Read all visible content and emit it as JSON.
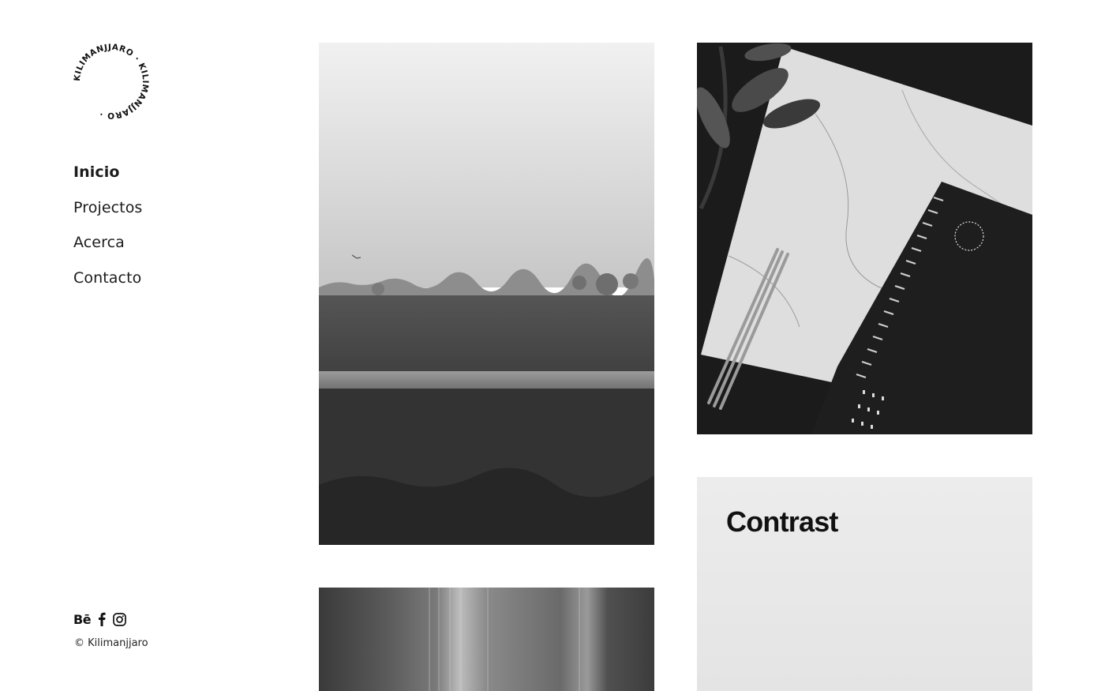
{
  "brand": {
    "logo_text": "KILIMANJJARO · KILIMANJJARO ·",
    "name": "Kilimanjjaro"
  },
  "nav": {
    "items": [
      {
        "label": "Inicio",
        "active": true
      },
      {
        "label": "Projectos",
        "active": false
      },
      {
        "label": "Acerca",
        "active": false
      },
      {
        "label": "Contacto",
        "active": false
      }
    ]
  },
  "social": {
    "behance_label": "Bē",
    "icons": [
      "behance-icon",
      "facebook-icon",
      "instagram-icon"
    ]
  },
  "footer": {
    "copyright": "© Kilimanjjaro"
  },
  "projects": [
    {
      "image": "foggy-field-photo"
    },
    {
      "image": "notebook-marble-photo"
    },
    {
      "image": "light-streaks-photo"
    },
    {
      "title": "Contrast"
    }
  ],
  "colors": {
    "background": "#ffffff",
    "text": "#151515",
    "card": "#ebebeb"
  }
}
